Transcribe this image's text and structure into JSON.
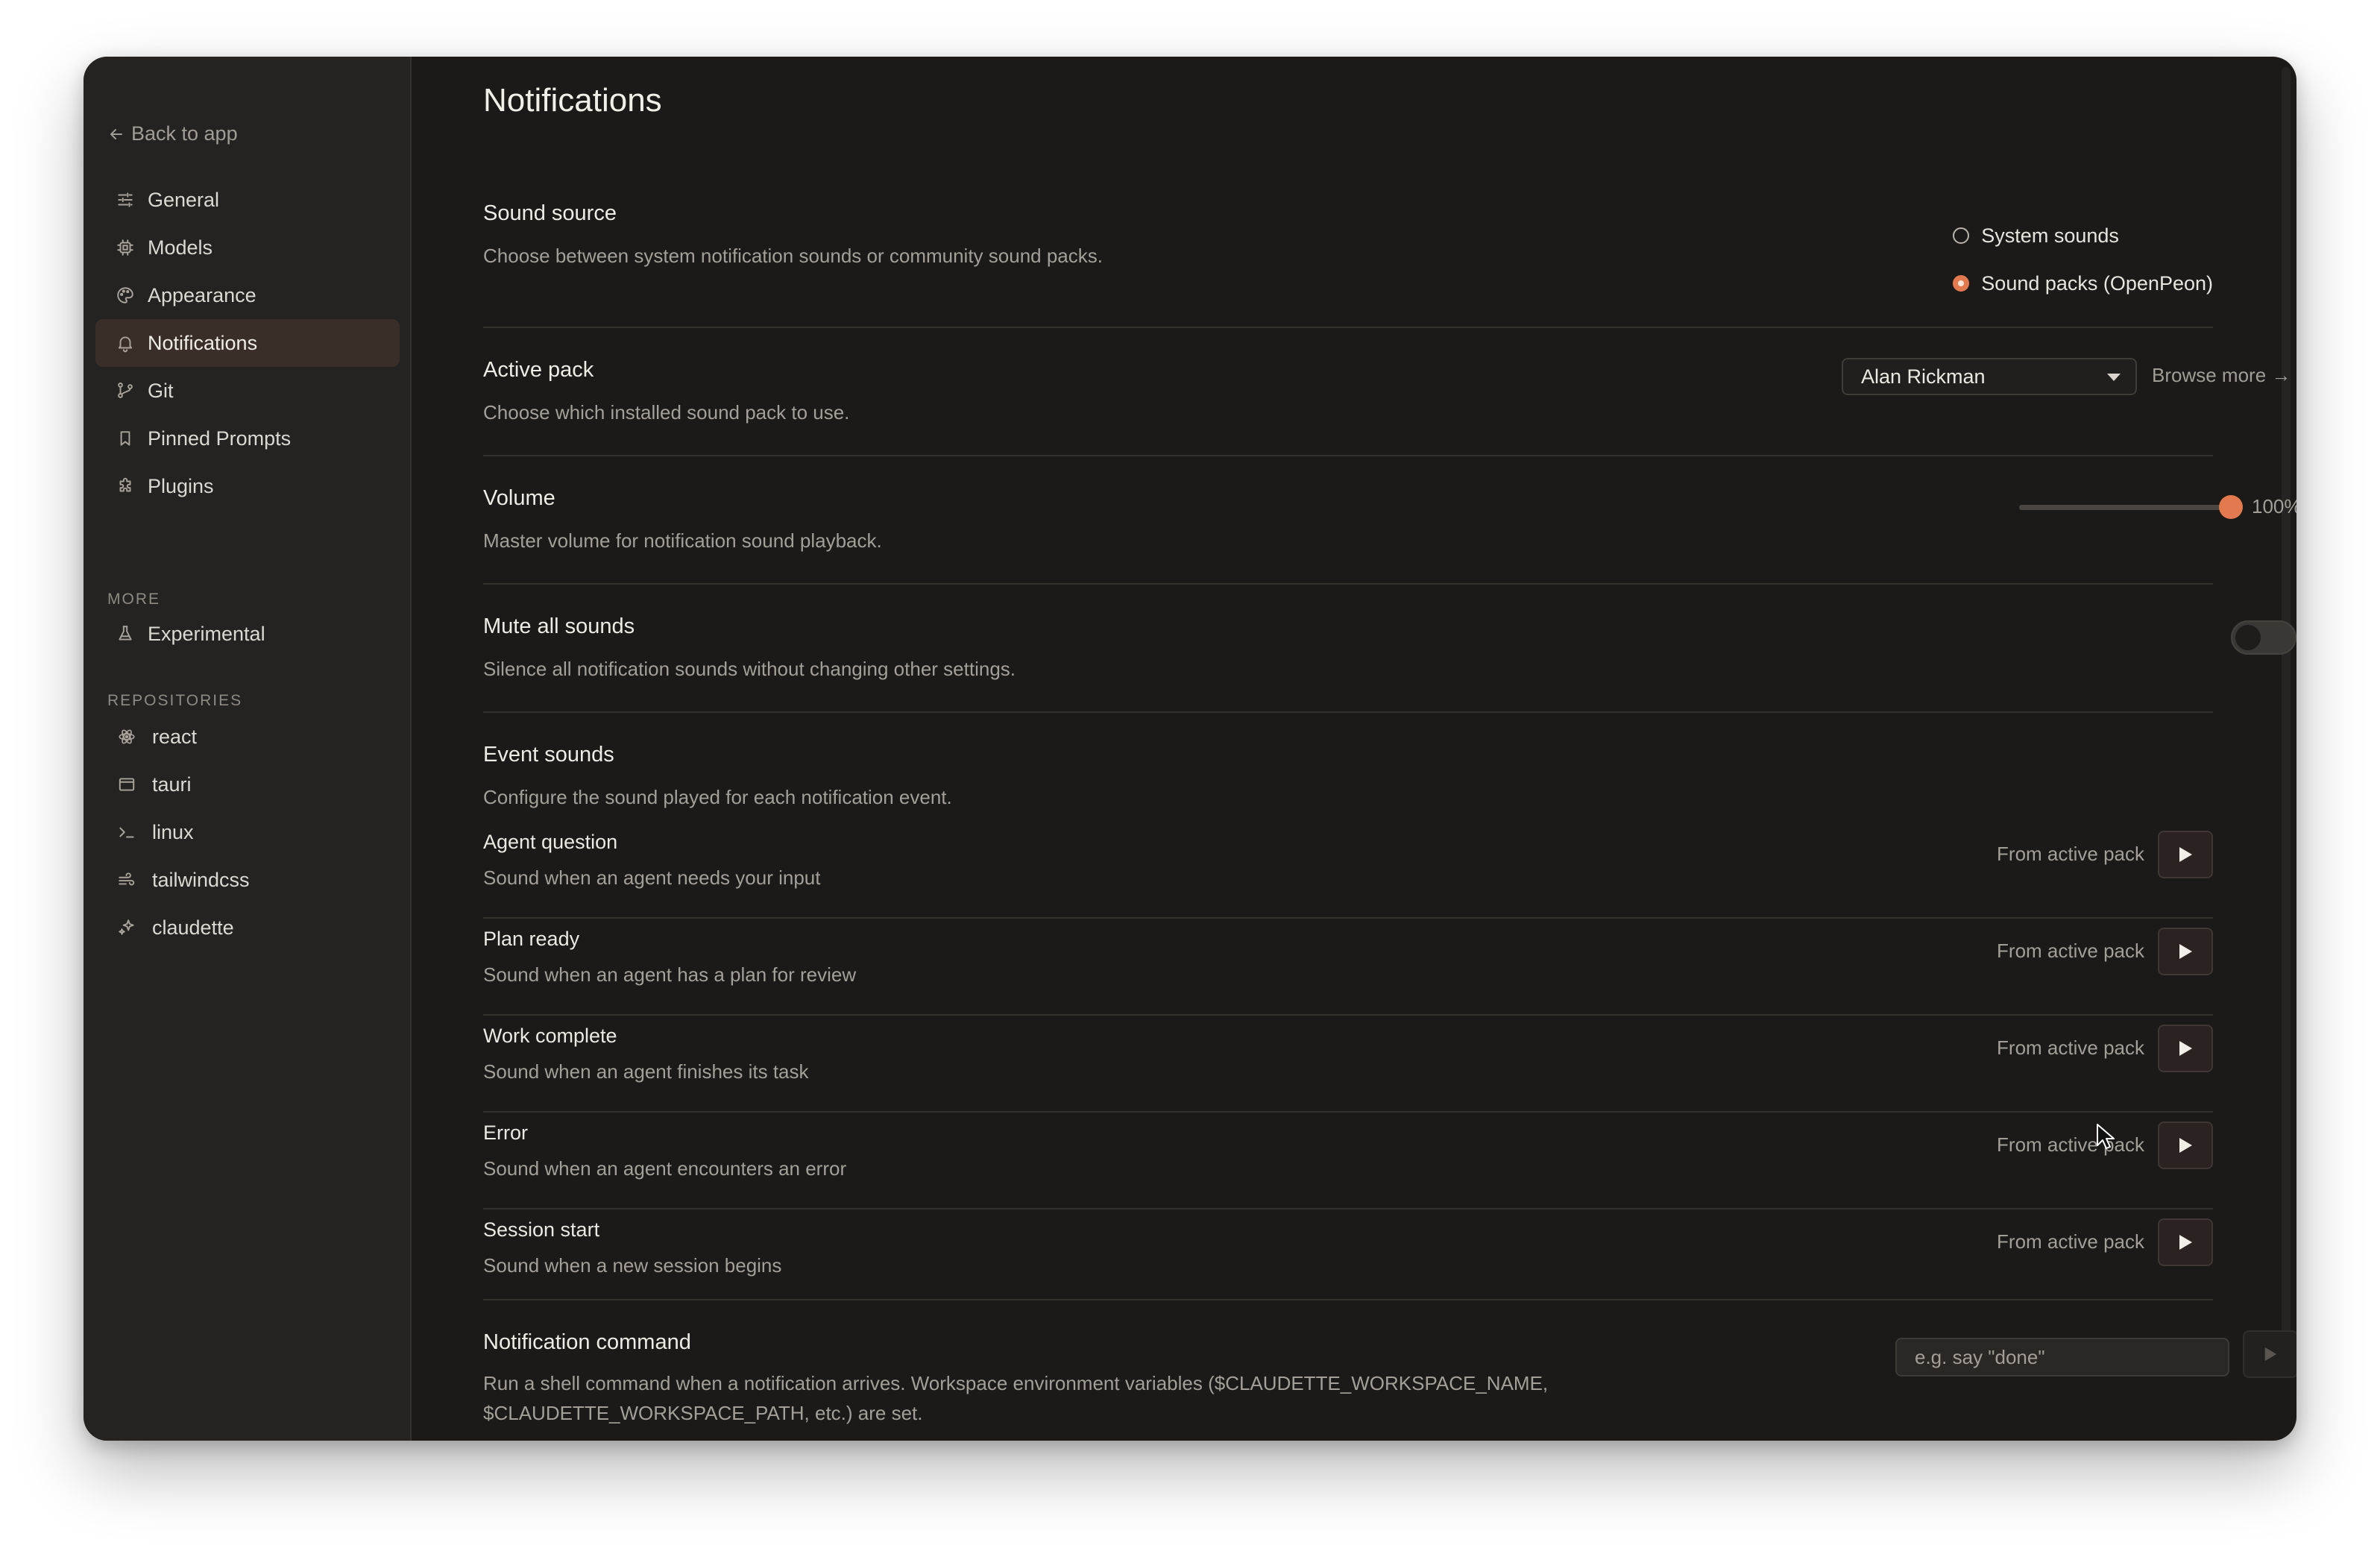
{
  "sidebar": {
    "back_label": "Back to app",
    "nav": [
      {
        "label": "General",
        "icon": "sliders-icon"
      },
      {
        "label": "Models",
        "icon": "chip-icon"
      },
      {
        "label": "Appearance",
        "icon": "palette-icon"
      },
      {
        "label": "Notifications",
        "icon": "bell-icon",
        "active": true
      },
      {
        "label": "Git",
        "icon": "git-branch-icon"
      },
      {
        "label": "Pinned Prompts",
        "icon": "bookmark-icon"
      },
      {
        "label": "Plugins",
        "icon": "puzzle-icon"
      }
    ],
    "more_label": "MORE",
    "more_items": [
      {
        "label": "Experimental",
        "icon": "flask-icon"
      }
    ],
    "repos_label": "REPOSITORIES",
    "repos": [
      {
        "label": "react",
        "icon": "atom-icon"
      },
      {
        "label": "tauri",
        "icon": "window-icon"
      },
      {
        "label": "linux",
        "icon": "terminal-icon"
      },
      {
        "label": "tailwindcss",
        "icon": "wind-icon"
      },
      {
        "label": "claudette",
        "icon": "sparkle-icon"
      }
    ]
  },
  "page": {
    "title": "Notifications",
    "sound_source": {
      "title": "Sound source",
      "description": "Choose between system notification sounds or community sound packs.",
      "options": [
        "System sounds",
        "Sound packs (OpenPeon)"
      ],
      "selected_index": 1
    },
    "active_pack": {
      "title": "Active pack",
      "description": "Choose which installed sound pack to use.",
      "selected": "Alan Rickman",
      "browse_label": "Browse more →"
    },
    "volume": {
      "title": "Volume",
      "description": "Master volume for notification sound playback.",
      "value_percent": 100,
      "value_label": "100%"
    },
    "mute": {
      "title": "Mute all sounds",
      "description": "Silence all notification sounds without changing other settings.",
      "enabled": false
    },
    "events": {
      "title": "Event sounds",
      "description": "Configure the sound played for each notification event.",
      "items": [
        {
          "title": "Agent question",
          "description": "Sound when an agent needs your input",
          "source": "From active pack"
        },
        {
          "title": "Plan ready",
          "description": "Sound when an agent has a plan for review",
          "source": "From active pack"
        },
        {
          "title": "Work complete",
          "description": "Sound when an agent finishes its task",
          "source": "From active pack"
        },
        {
          "title": "Error",
          "description": "Sound when an agent encounters an error",
          "source": "From active pack"
        },
        {
          "title": "Session start",
          "description": "Sound when a new session begins",
          "source": "From active pack"
        }
      ]
    },
    "command": {
      "title": "Notification command",
      "description_line1": "Run a shell command when a notification arrives. Workspace environment variables ($CLAUDETTE_WORKSPACE_NAME,",
      "description_line2": "$CLAUDETTE_WORKSPACE_PATH, etc.) are set.",
      "placeholder": "e.g. say \"done\""
    }
  },
  "colors": {
    "accent": "#e37a4f",
    "window_bg": "#1c1a18",
    "sidebar_bg": "#252321",
    "active_nav_bg": "#3a2e28"
  }
}
